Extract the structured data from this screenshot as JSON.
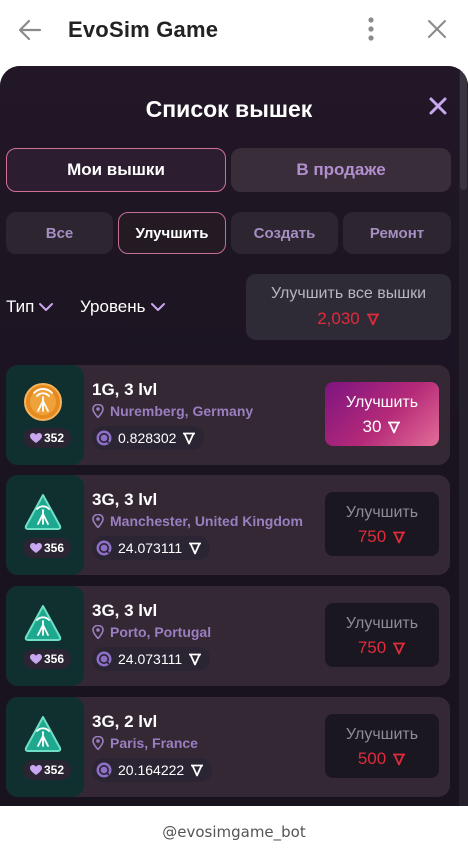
{
  "window": {
    "title": "EvoSim Game",
    "back_icon": "arrow-left-icon",
    "menu_icon": "kebab-menu-icon",
    "close_icon": "close-icon"
  },
  "modal": {
    "title": "Список вышек",
    "close_icon": "close-icon",
    "tabs": [
      {
        "label": "Мои вышки",
        "active": true
      },
      {
        "label": "В продаже",
        "active": false
      }
    ],
    "filters": [
      {
        "label": "Все",
        "active": false
      },
      {
        "label": "Улучшить",
        "active": true
      },
      {
        "label": "Создать",
        "active": false
      },
      {
        "label": "Ремонт",
        "active": false
      }
    ],
    "sort": {
      "type_label": "Тип",
      "level_label": "Уровень"
    },
    "upgrade_all": {
      "label": "Улучшить все вышки",
      "price": "2,030"
    },
    "towers": [
      {
        "title": "1G, 3 lvl",
        "location": "Nuremberg, Germany",
        "yield": "0.828302",
        "hp": "352",
        "icon": "orange-antenna-icon",
        "upgrade_label": "Улучшить",
        "upgrade_price": "30",
        "active": true
      },
      {
        "title": "3G, 3 lvl",
        "location": "Manchester, United Kingdom",
        "yield": "24.073111",
        "hp": "356",
        "icon": "teal-antenna-icon",
        "upgrade_label": "Улучшить",
        "upgrade_price": "750",
        "active": false
      },
      {
        "title": "3G, 3 lvl",
        "location": "Porto, Portugal",
        "yield": "24.073111",
        "hp": "356",
        "icon": "teal-antenna-icon",
        "upgrade_label": "Улучшить",
        "upgrade_price": "750",
        "active": false
      },
      {
        "title": "3G, 2 lvl",
        "location": "Paris, France",
        "yield": "20.164222",
        "hp": "352",
        "icon": "teal-antenna-icon",
        "upgrade_label": "Улучшить",
        "upgrade_price": "500",
        "active": false
      }
    ]
  },
  "footer": {
    "bot_name": "@evosimgame_bot"
  },
  "colors": {
    "price_red": "#e02b3b",
    "accent_pink": "#d37095",
    "location_purple": "#9a7fc0"
  }
}
